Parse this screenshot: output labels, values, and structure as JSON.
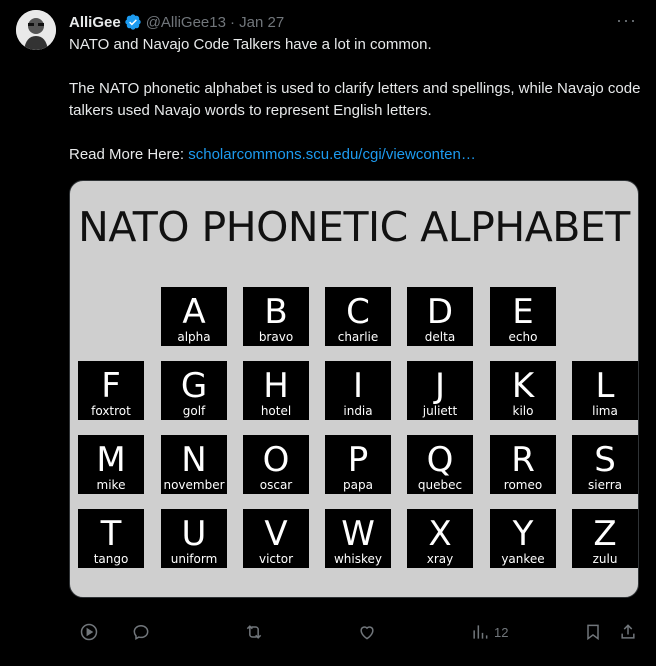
{
  "author": {
    "name": "AlliGee",
    "handle": "@AlliGee13",
    "date": "· Jan 27"
  },
  "tweet": {
    "line1": "NATO and Navajo Code Talkers have a lot in common.",
    "line2": "The NATO phonetic alphabet is used to clarify letters and spellings, while Navajo code talkers used Navajo words to represent English letters.",
    "read_more_label": "Read More Here:",
    "link_text": "scholarcommons.scu.edu/cgi/viewconten…"
  },
  "media": {
    "title": "NATO PHONETIC ALPHABET",
    "tiles": [
      {
        "letter": "A",
        "word": "alpha"
      },
      {
        "letter": "B",
        "word": "bravo"
      },
      {
        "letter": "C",
        "word": "charlie"
      },
      {
        "letter": "D",
        "word": "delta"
      },
      {
        "letter": "E",
        "word": "echo"
      },
      {
        "letter": "F",
        "word": "foxtrot"
      },
      {
        "letter": "G",
        "word": "golf"
      },
      {
        "letter": "H",
        "word": "hotel"
      },
      {
        "letter": "I",
        "word": "india"
      },
      {
        "letter": "J",
        "word": "juliett"
      },
      {
        "letter": "K",
        "word": "kilo"
      },
      {
        "letter": "L",
        "word": "lima"
      },
      {
        "letter": "M",
        "word": "mike"
      },
      {
        "letter": "N",
        "word": "november"
      },
      {
        "letter": "O",
        "word": "oscar"
      },
      {
        "letter": "P",
        "word": "papa"
      },
      {
        "letter": "Q",
        "word": "quebec"
      },
      {
        "letter": "R",
        "word": "romeo"
      },
      {
        "letter": "S",
        "word": "sierra"
      },
      {
        "letter": "T",
        "word": "tango"
      },
      {
        "letter": "U",
        "word": "uniform"
      },
      {
        "letter": "V",
        "word": "victor"
      },
      {
        "letter": "W",
        "word": "whiskey"
      },
      {
        "letter": "X",
        "word": "xray"
      },
      {
        "letter": "Y",
        "word": "yankee"
      },
      {
        "letter": "Z",
        "word": "zulu"
      }
    ]
  },
  "actions": {
    "views_count": "12"
  },
  "colors": {
    "background": "#000000",
    "text": "#e7e9ea",
    "muted": "#71767b",
    "link": "#1d9bf0",
    "verified": "#1d9bf0"
  },
  "icons": [
    "avatar",
    "verified-badge-icon",
    "more-icon",
    "play-icon",
    "reply-icon",
    "retweet-icon",
    "like-icon",
    "views-icon",
    "bookmark-icon",
    "share-icon"
  ]
}
